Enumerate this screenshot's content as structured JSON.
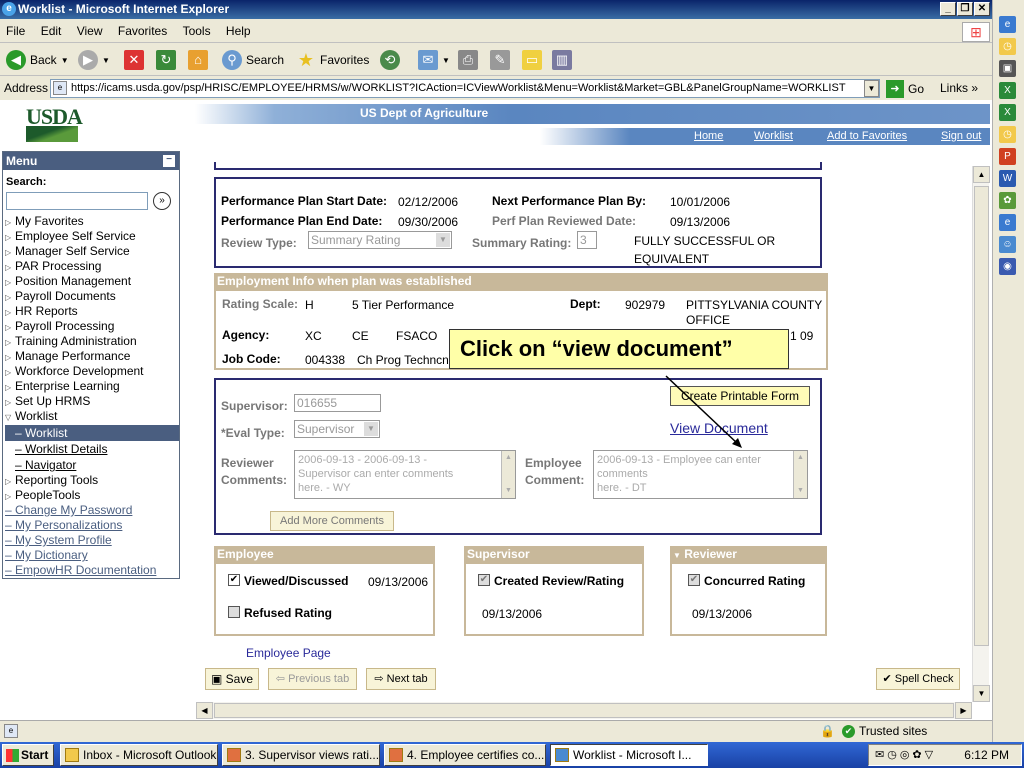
{
  "window": {
    "title": "Worklist - Microsoft Internet Explorer"
  },
  "menubar": [
    "File",
    "Edit",
    "View",
    "Favorites",
    "Tools",
    "Help"
  ],
  "toolbar": {
    "back": "Back",
    "search": "Search",
    "favorites": "Favorites"
  },
  "address": {
    "label": "Address",
    "url": "https://icams.usda.gov/psp/HRISC/EMPLOYEE/HRMS/w/WORKLIST?ICAction=ICViewWorklist&Menu=Worklist&Market=GBL&PanelGroupName=WORKLIST",
    "go": "Go",
    "links": "Links"
  },
  "header": {
    "logo": "USDA",
    "dept": "US Dept of Agriculture",
    "links": [
      "Home",
      "Worklist",
      "Add to Favorites",
      "Sign out"
    ]
  },
  "menu": {
    "title": "Menu",
    "search_label": "Search:",
    "items": [
      "My Favorites",
      "Employee Self Service",
      "Manager Self Service",
      "PAR Processing",
      "Position Management",
      "Payroll Documents",
      "HR Reports",
      "Payroll Processing",
      "Training Administration",
      "Manage Performance",
      "Workforce Development",
      "Enterprise Learning",
      "Set Up HRMS"
    ],
    "worklist": "Worklist",
    "worklist_sub": [
      "Worklist",
      "Worklist Details",
      "Navigator"
    ],
    "items2": [
      "Reporting Tools",
      "PeopleTools"
    ],
    "links": [
      "Change My Password",
      "My Personalizations",
      "My System Profile",
      "My Dictionary",
      "EmpowHR Documentation"
    ]
  },
  "plan": {
    "start_label": "Performance Plan Start Date:",
    "start": "02/12/2006",
    "next_label": "Next Performance Plan By:",
    "next": "10/01/2006",
    "end_label": "Performance Plan End Date:",
    "end": "09/30/2006",
    "reviewed_label": "Perf Plan Reviewed Date:",
    "reviewed": "09/13/2006",
    "review_type_label": "Review Type:",
    "review_type": "Summary Rating",
    "summary_label": "Summary Rating:",
    "summary": "3",
    "summary_text1": "FULLY SUCCESSFUL OR",
    "summary_text2": "EQUIVALENT"
  },
  "employment": {
    "title": "Employment Info when plan was established",
    "scale_label": "Rating Scale:",
    "scale": "H",
    "scale_desc": "5 Tier Performance",
    "dept_label": "Dept:",
    "dept": "902979",
    "dept_name1": "PITTSYLVANIA COUNTY",
    "dept_name2": "OFFICE",
    "agency_label": "Agency:",
    "agency": "XC",
    "agency2": "CE",
    "agency3": "FSACO",
    "agency_tail": "1 09",
    "job_label": "Job Code:",
    "job": "004338",
    "job_desc": "Ch Prog Techncn"
  },
  "callout": "Click on “view document”",
  "review": {
    "create_form": "Create Printable Form",
    "view_doc": "View Document",
    "supervisor_label": "Supervisor:",
    "supervisor": "016655",
    "eval_label": "*Eval Type:",
    "eval": "Supervisor",
    "reviewer_label1": "Reviewer",
    "reviewer_label2": "Comments:",
    "reviewer_text": [
      "2006-09-13 - 2006-09-13 -",
      "Supervisor can enter comments",
      "here. - WY"
    ],
    "employee_label1": "Employee",
    "employee_label2": "Comment:",
    "employee_text": [
      "2006-09-13 - Employee can enter",
      "comments",
      "here. - DT"
    ],
    "add_comments": "Add More Comments"
  },
  "employee_box": {
    "title": "Employee",
    "viewed": "Viewed/Discussed",
    "viewed_date": "09/13/2006",
    "refused": "Refused Rating"
  },
  "supervisor_box": {
    "title": "Supervisor",
    "created": "Created Review/Rating",
    "date": "09/13/2006"
  },
  "reviewer_box": {
    "title": "Reviewer",
    "concurred": "Concurred Rating",
    "date": "09/13/2006"
  },
  "employee_page": "Employee Page",
  "buttons": {
    "save": "Save",
    "prev": "Previous tab",
    "next": "Next tab",
    "spell": "Spell Check"
  },
  "status": {
    "zone": "Trusted sites"
  },
  "taskbar": {
    "start": "Start",
    "tasks": [
      "Inbox - Microsoft Outlook",
      "3.  Supervisor views rati...",
      "4.  Employee certifies co...",
      "Worklist - Microsoft I..."
    ],
    "time": "6:12 PM"
  }
}
